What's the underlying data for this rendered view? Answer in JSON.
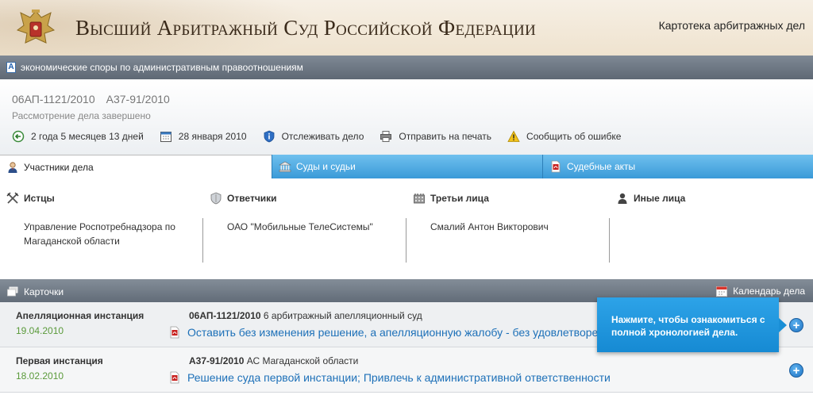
{
  "header": {
    "court_title": "Высший Арбитражный Суд Российской Федерации",
    "kartoteka_link": "Картотека арбитражных дел"
  },
  "category": {
    "icon": "letter-a-icon",
    "text": "экономические споры по административным правоотношениям"
  },
  "case": {
    "number_appeal": "06АП-1121/2010",
    "number_first": "А37-91/2010",
    "status": "Рассмотрение дела завершено",
    "actions": [
      {
        "icon": "duration-arrow-icon",
        "label": "2 года 5 месяцев 13 дней"
      },
      {
        "icon": "calendar-icon",
        "label": "28 января 2010"
      },
      {
        "icon": "shield-info-icon",
        "label": "Отслеживать дело"
      },
      {
        "icon": "printer-icon",
        "label": "Отправить на печать"
      },
      {
        "icon": "warning-icon",
        "label": "Сообщить об ошибке"
      }
    ]
  },
  "tabs": [
    {
      "label": "Участники дела",
      "icon": "person-icon",
      "active": true
    },
    {
      "label": "Суды и судьи",
      "icon": "courthouse-icon",
      "active": false
    },
    {
      "label": "Судебные акты",
      "icon": "pdf-icon",
      "active": false
    }
  ],
  "participants": [
    {
      "heading": "Истцы",
      "icon": "crossed-swords-icon",
      "items": [
        "Управление Роспотребнадзора по Магаданской области"
      ]
    },
    {
      "heading": "Ответчики",
      "icon": "shield-icon",
      "items": [
        "ОАО \"Мобильные ТелеСистемы\""
      ]
    },
    {
      "heading": "Третьи лица",
      "icon": "building-icon",
      "items": [
        "Смалий Антон Викторович"
      ]
    },
    {
      "heading": "Иные лица",
      "icon": "person-silhouette-icon",
      "items": []
    }
  ],
  "cards_bar": {
    "title": "Карточки",
    "calendar_link": "Календарь дела"
  },
  "instances": [
    {
      "name": "Апелляционная инстанция",
      "date": "19.04.2010",
      "case_number": "06АП-1121/2010",
      "court": "6 арбитражный апелляционный суд",
      "document": "Оставить без изменения решение, а апелляционную жалобу - без удовлетворения"
    },
    {
      "name": "Первая инстанция",
      "date": "18.02.2010",
      "case_number": "А37-91/2010",
      "court": "АС Магаданской области",
      "document": "Решение суда первой инстанции; Привлечь к административной ответственности"
    }
  ],
  "tooltip": {
    "text": "Нажмите, чтобы ознакомиться с полной хронологией дела."
  },
  "colors": {
    "tab_blue": "#3a9ad8",
    "link_blue": "#1d70b8",
    "date_green": "#5a9a3a",
    "tooltip_blue": "#168ad3",
    "bar_gray": "#6c7682"
  }
}
